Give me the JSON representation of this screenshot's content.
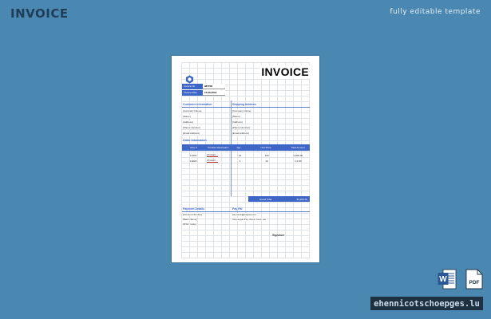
{
  "header": {
    "title": "INVOICE",
    "subtitle": "fully editable template"
  },
  "invoice": {
    "heading": "INVOICE",
    "meta": [
      {
        "label": "Invoice No.",
        "value": "987158"
      },
      {
        "label": "Invoice Date",
        "value": "15-06-2019"
      }
    ],
    "customer": {
      "title": "Customer Information",
      "lines": [
        "[Company Name]",
        "[Name]",
        "[Address]",
        "[Phone Number]",
        "[Email Address]"
      ]
    },
    "shipping": {
      "title": "Shipping Address",
      "lines": [
        "[Company Name]",
        "[Name]",
        "[Address]",
        "[Phone Number]",
        "[Email Address]"
      ]
    },
    "order": {
      "title": "Order Information",
      "columns": [
        "Item #",
        "Product Description",
        "Qty",
        "Unit Price",
        "Total Amount"
      ],
      "rows": [
        {
          "item": "10131",
          "product": "Product ...",
          "qty": "10",
          "unit_price": "100",
          "total": "1,000.00"
        },
        {
          "item": "12022",
          "product": "Product ...",
          "qty": "1",
          "unit_price": "10",
          "total": "1,0.00"
        }
      ],
      "grand_total_label": "Grand Total",
      "grand_total_value": "$1,200.00"
    },
    "payment": {
      "title": "Payment Details",
      "lines": [
        "[Account Number]",
        "[Bank Name]",
        "[IFSC Code]"
      ]
    },
    "paypal": {
      "title": "Pay Pal",
      "lines": [
        "payment@paypal.com",
        "Via paypal Pay, Resin Card, etc."
      ]
    },
    "signature": "Signature"
  },
  "footer": {
    "watermark": "ehennicotschoepges.lu",
    "icons": [
      "word-icon",
      "pdf-icon"
    ],
    "pdf_label": "PDF"
  },
  "colors": {
    "background": "#4a88b2",
    "accent": "#3e66c6",
    "title": "#1f3d57"
  }
}
